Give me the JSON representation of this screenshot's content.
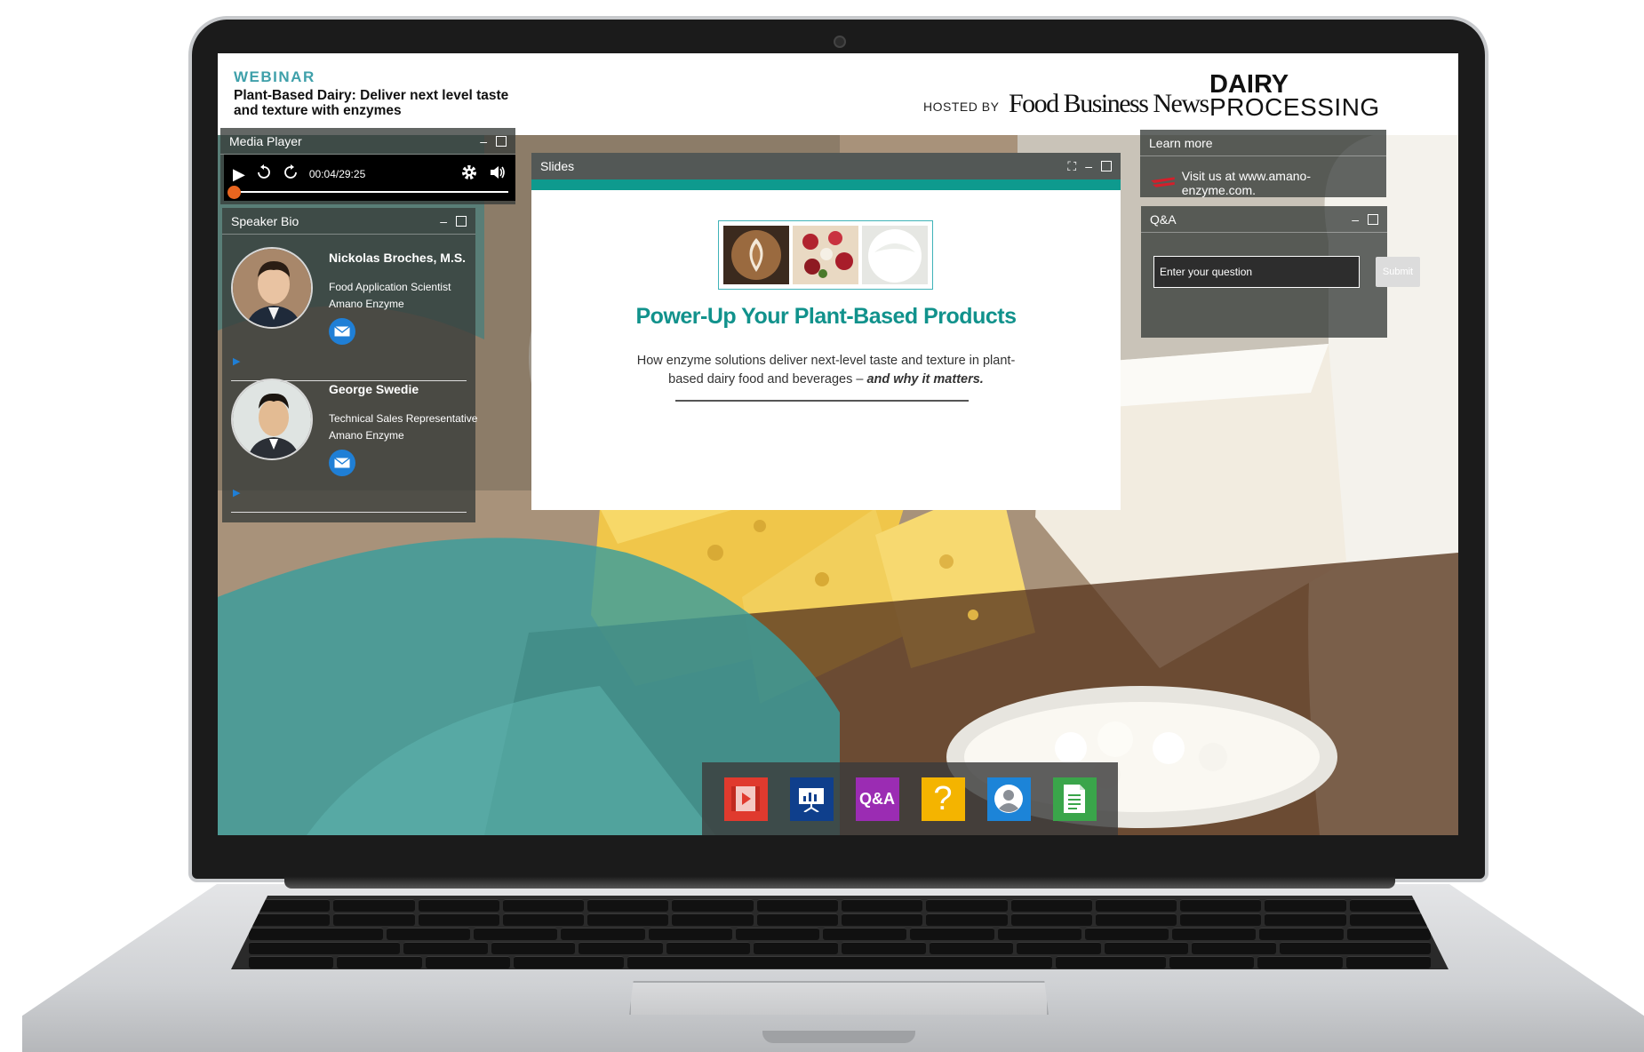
{
  "header": {
    "tag": "WEBINAR",
    "title": "Plant-Based Dairy: Deliver next level taste and texture with enzymes",
    "hosted_by": "HOSTED BY",
    "logo_fbn": "Food Business News",
    "logo_dairy_line1": "DAIRY",
    "logo_dairy_line2": "PROCESSING"
  },
  "media_player": {
    "title": "Media Player",
    "time": "00:04/29:25",
    "progress": 0.002,
    "icons": [
      "play-icon",
      "rewind-15-icon",
      "forward-15-icon",
      "gear-icon",
      "volume-icon"
    ]
  },
  "speaker_bio": {
    "title": "Speaker Bio",
    "speakers": [
      {
        "name": "Nickolas Broches, M.S.",
        "role": "Food Application Scientist",
        "company": "Amano Enzyme"
      },
      {
        "name": "George Swedie",
        "role": "Technical Sales Representative",
        "company": "Amano Enzyme"
      }
    ]
  },
  "slides": {
    "title": "Slides",
    "heading": "Power-Up Your Plant-Based Products",
    "subtitle_main": "How enzyme solutions deliver next-level taste and texture in plant-based dairy food and beverages –",
    "subtitle_emphasis": "and why it matters."
  },
  "learn_more": {
    "title": "Learn more",
    "link_text": "Visit us at www.amano-enzyme.com."
  },
  "qa": {
    "title": "Q&A",
    "input_placeholder": "Enter your question",
    "submit_label": "Submit"
  },
  "toolbar": {
    "qa_label": "Q&A",
    "help_label": "?",
    "buttons": [
      {
        "icon": "media-player-icon",
        "color": "#e03a2e"
      },
      {
        "icon": "slides-icon",
        "color": "#0f3f8c"
      },
      {
        "icon": "qa-icon",
        "color": "#9b2cb3"
      },
      {
        "icon": "help-icon",
        "color": "#f4b400"
      },
      {
        "icon": "speaker-bio-icon",
        "color": "#1c84d8"
      },
      {
        "icon": "resources-icon",
        "color": "#3aa54a"
      }
    ]
  },
  "colors": {
    "accent_teal": "#11928c",
    "header_teal": "#3fa0aa",
    "progress_knob": "#e8651f"
  }
}
